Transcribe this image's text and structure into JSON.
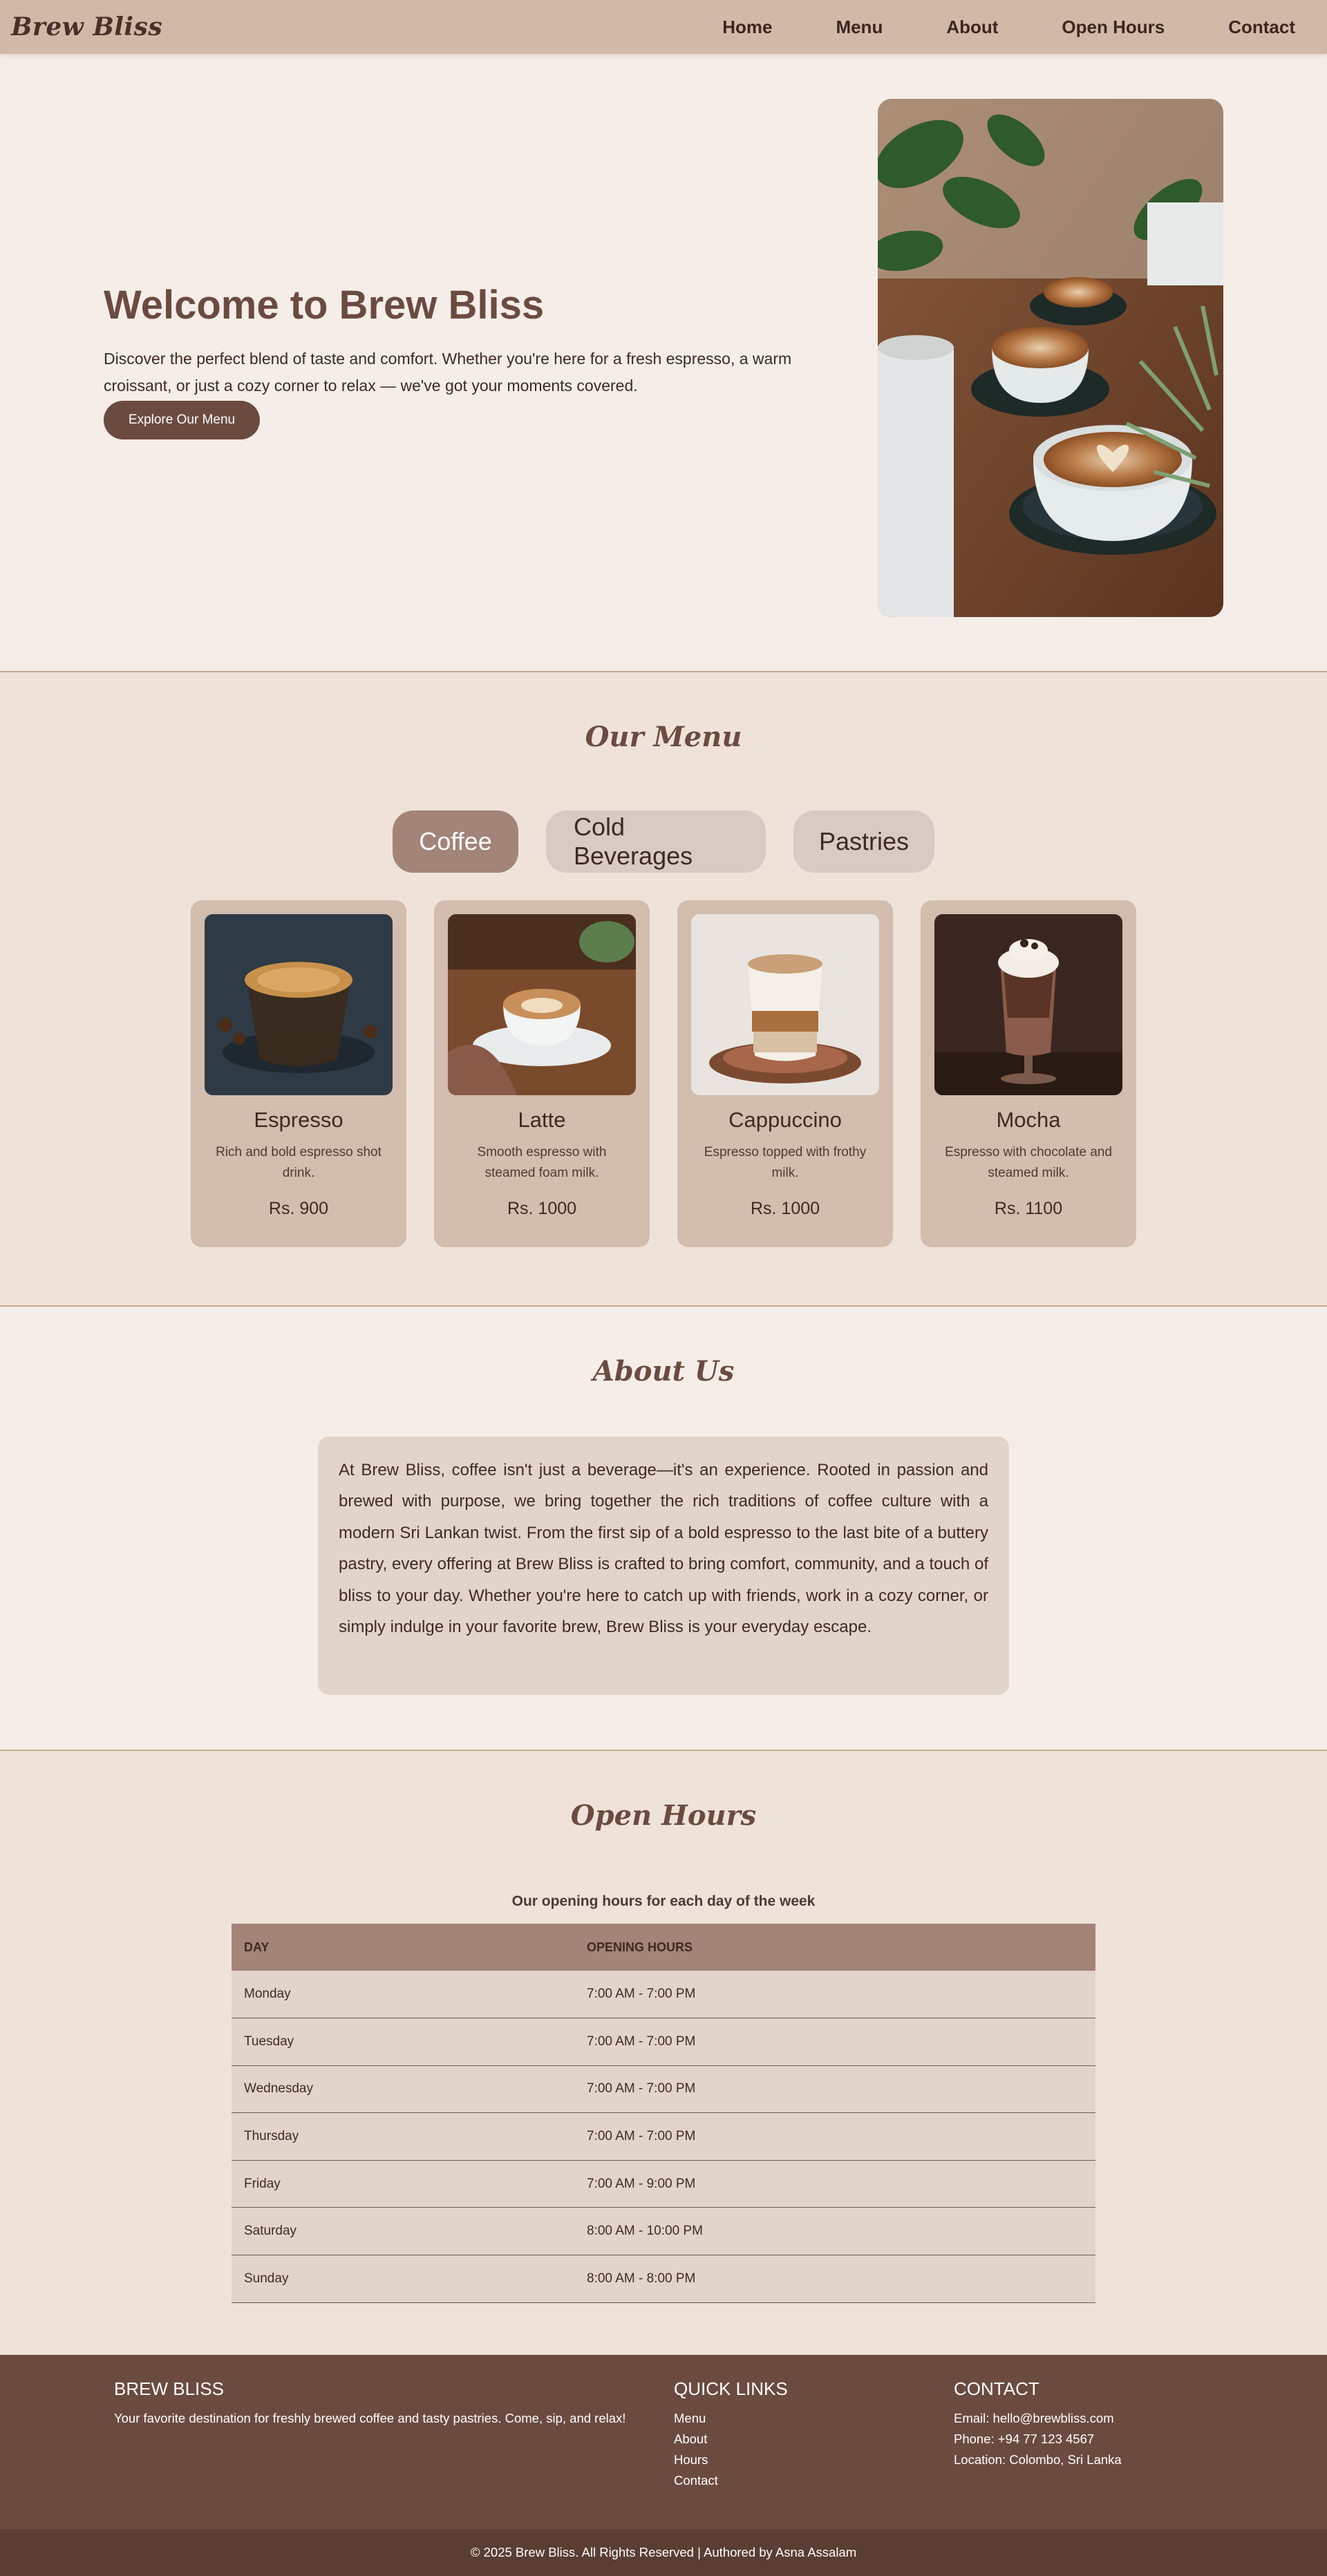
{
  "nav": {
    "logo": "Brew Bliss",
    "links": [
      "Home",
      "Menu",
      "About",
      "Open Hours",
      "Contact"
    ]
  },
  "hero": {
    "title": "Welcome to Brew Bliss",
    "text": "Discover the perfect blend of taste and comfort. Whether you're here for a fresh espresso, a warm croissant, or just a cozy corner to relax — we've got your moments covered.",
    "button": "Explore Our Menu",
    "image": "coffee-cups-with-latte-art-and-plants"
  },
  "menu": {
    "title": "Our Menu",
    "tabs": [
      {
        "label": "Coffee",
        "active": true
      },
      {
        "label": "Cold Beverages",
        "active": false
      },
      {
        "label": "Pastries",
        "active": false
      }
    ],
    "items": [
      {
        "name": "Espresso",
        "desc": "Rich and bold espresso shot drink.",
        "price": "Rs. 900",
        "image": "espresso-glass"
      },
      {
        "name": "Latte",
        "desc": "Smooth espresso with steamed foam milk.",
        "price": "Rs. 1000",
        "image": "latte-cup"
      },
      {
        "name": "Cappuccino",
        "desc": "Espresso topped with frothy milk.",
        "price": "Rs. 1000",
        "image": "cappuccino-glass"
      },
      {
        "name": "Mocha",
        "desc": "Espresso with chocolate and steamed milk.",
        "price": "Rs. 1100",
        "image": "mocha-glass"
      }
    ]
  },
  "about": {
    "title": "About Us",
    "text": "At Brew Bliss, coffee isn't just a beverage—it's an experience. Rooted in passion and brewed with purpose, we bring together the rich traditions of coffee culture with a modern Sri Lankan twist. From the first sip of a bold espresso to the last bite of a buttery pastry, every offering at Brew Bliss is crafted to bring comfort, community, and a touch of bliss to your day. Whether you're here to catch up with friends, work in a cozy corner, or simply indulge in your favorite brew, Brew Bliss is your everyday escape."
  },
  "hours": {
    "title": "Open Hours",
    "caption": "Our opening hours for each day of the week",
    "headers": [
      "DAY",
      "OPENING HOURS"
    ],
    "rows": [
      [
        "Monday",
        "7:00 AM - 7:00 PM"
      ],
      [
        "Tuesday",
        "7:00 AM - 7:00 PM"
      ],
      [
        "Wednesday",
        "7:00 AM - 7:00 PM"
      ],
      [
        "Thursday",
        "7:00 AM - 7:00 PM"
      ],
      [
        "Friday",
        "7:00 AM - 9:00 PM"
      ],
      [
        "Saturday",
        "8:00 AM - 10:00 PM"
      ],
      [
        "Sunday",
        "8:00 AM - 8:00 PM"
      ]
    ]
  },
  "footer": {
    "brand_title": "BREW BLISS",
    "brand_text": "Your favorite destination for freshly brewed coffee and tasty pastries. Come, sip, and relax!",
    "links_title": "QUICK LINKS",
    "links": [
      "Menu",
      "About",
      "Hours",
      "Contact"
    ],
    "contact_title": "CONTACT",
    "email": "Email: hello@brewbliss.com",
    "phone": "Phone: +94 77 123 4567",
    "location": "Location: Colombo, Sri Lanka",
    "copyright": "© 2025 Brew Bliss. All Rights Reserved | Authored by Asna Assalam"
  }
}
